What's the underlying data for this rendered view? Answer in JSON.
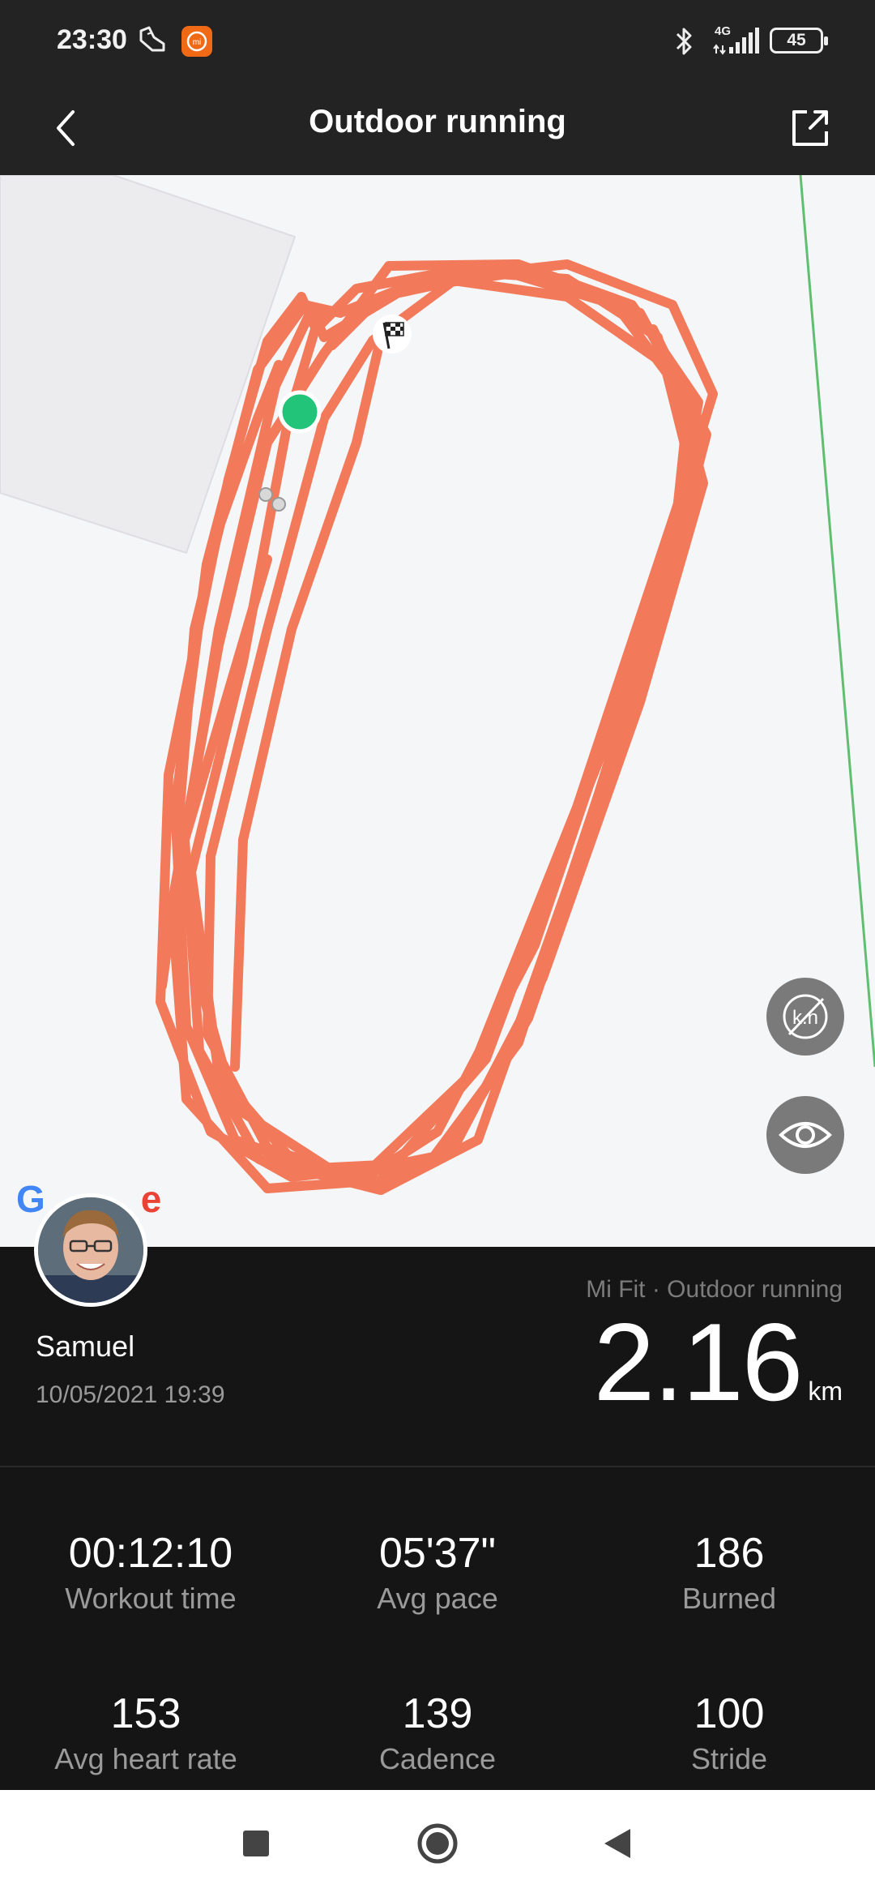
{
  "status_bar": {
    "time": "23:30",
    "network": "4G",
    "battery": "45",
    "icons": [
      "shoe-notification-icon",
      "mi-app-icon",
      "bluetooth-icon",
      "signal-icon",
      "battery-icon"
    ]
  },
  "header": {
    "title": "Outdoor running",
    "back_icon": "chevron-left-icon",
    "share_icon": "share-icon"
  },
  "map": {
    "route_color": "#f27a5a",
    "start_marker_color": "#22c47a",
    "finish_marker": "checkered-flag-icon",
    "buttons": [
      "hide-km-markers-icon",
      "eye-icon"
    ],
    "attribution": "Google"
  },
  "user": {
    "name": "Samuel",
    "date": "10/05/2021 19:39"
  },
  "summary": {
    "source": "Mi Fit · Outdoor running",
    "distance": "2.16",
    "distance_unit": "km"
  },
  "stats": [
    {
      "value": "00:12:10",
      "label": "Workout time"
    },
    {
      "value": "05'37\"",
      "label": "Avg pace"
    },
    {
      "value": "186",
      "label": "Burned"
    },
    {
      "value": "153",
      "label": "Avg heart rate"
    },
    {
      "value": "139",
      "label": "Cadence"
    },
    {
      "value": "100",
      "label": "Stride"
    }
  ],
  "nav": [
    "recents-square-icon",
    "home-circle-icon",
    "back-triangle-icon"
  ]
}
